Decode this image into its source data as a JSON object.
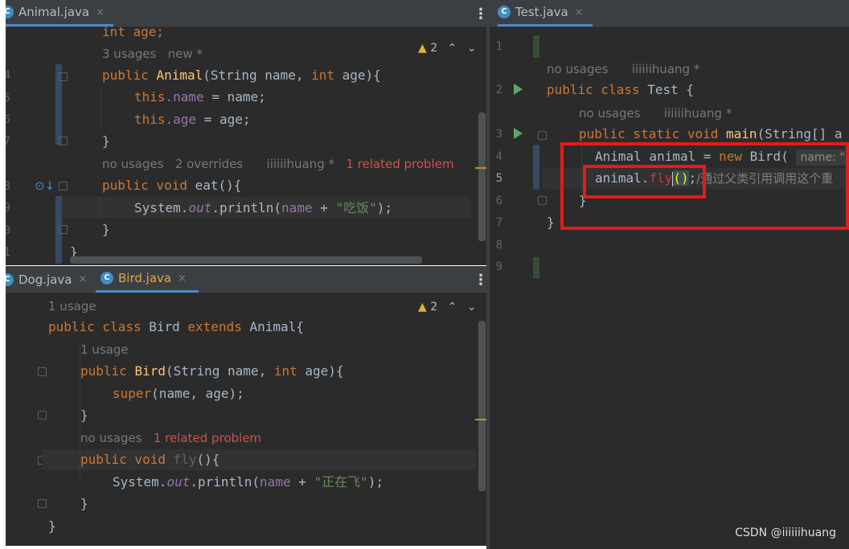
{
  "colors": {
    "editor_bg": "#2b2b2b",
    "keyword": "#cc7832",
    "function": "#ffc66d",
    "field": "#9876aa",
    "string": "#6a8759",
    "text": "#a9b7c6",
    "hint": "#787878",
    "problem": "#c75450",
    "highlight_box": "#e41b1b"
  },
  "top_left": {
    "tab": {
      "label": "Animal.java",
      "icon": "class-c-icon",
      "close": "×"
    },
    "warnings": "2",
    "line_numbers": [
      "4",
      "5",
      "6",
      "7",
      "8",
      "9",
      "0",
      "1"
    ],
    "lines": {
      "partial": "int age;",
      "hint1": "3 usages   new *",
      "ctor_public": "public ",
      "ctor_name": "Animal",
      "ctor_p1": "(String name, ",
      "ctor_int": "int",
      "ctor_p2": " age){",
      "this1": "this",
      "dot_name": ".name",
      "eq_name": " = name;",
      "this2": "this",
      "dot_age": ".age",
      "eq_age": " = age;",
      "close1": "}",
      "hint2_a": "no usages   2 overrides    iiiiiihuang *   ",
      "hint2_prob": "1 related problem",
      "eat_public": "public void ",
      "eat_name": "eat",
      "eat_rest": "(){",
      "sys": "System.",
      "out": "out",
      "println": ".println(",
      "name": "name",
      " plus": " + ",
      "str": "\"吃饭\"",
      "end": ");",
      "close2": "}",
      "close3": "}"
    }
  },
  "bottom_left": {
    "tabs": [
      {
        "label": "Dog.java",
        "close": "×"
      },
      {
        "label": "Bird.java",
        "close": "×"
      }
    ],
    "warnings": "2",
    "lines": {
      "hint1": "1 usage",
      "cls_public": "public class ",
      "cls_name": "Bird ",
      "cls_extends": "extends ",
      "cls_parent": "Animal{",
      "hint2": "1 usage",
      "ctor_public": "public ",
      "ctor_name": "Bird",
      "ctor_p1": "(String name, ",
      "ctor_int": "int",
      "ctor_p2": " age){",
      "super_kw": "super",
      "super_rest": "(name, age);",
      "close1": "}",
      "hint3_a": "no usages   ",
      "hint3_prob": "1 related problem",
      "fly_public": "public void ",
      "fly_name": "fly",
      "fly_rest": "(){",
      "sys": "System.",
      "out": "out",
      "println": ".println(",
      "name": "name",
      "plus": " + ",
      "str": "\"正在飞\"",
      "end": ");",
      "close2": "}",
      "close3": "}"
    }
  },
  "right": {
    "tab": {
      "label": "Test.java",
      "close": "×"
    },
    "line_numbers": [
      "1",
      "2",
      "3",
      "4",
      "5",
      "6",
      "7",
      "8",
      "9"
    ],
    "lines": {
      "hint1": "no usages    iiiiiihuang *",
      "cls_public": "public class ",
      "cls_name": "Test {",
      "hint2": "no usages    iiiiiihuang *",
      "main_kw": "public static void ",
      "main_name": "main",
      "main_rest": "(String[] a",
      "decl_a": "Animal animal = ",
      "decl_new": "new ",
      "decl_b": "Bird( ",
      "inlay": "name: \"",
      "call_a": "animal.",
      "call_fly": "fly",
      "call_paren": "()",
      "call_semi": ";",
      "call_comment": "/通过父类引用调用这个重",
      "close1": "}",
      "close2": "}"
    }
  },
  "watermark": "CSDN @iiiiiihuang"
}
